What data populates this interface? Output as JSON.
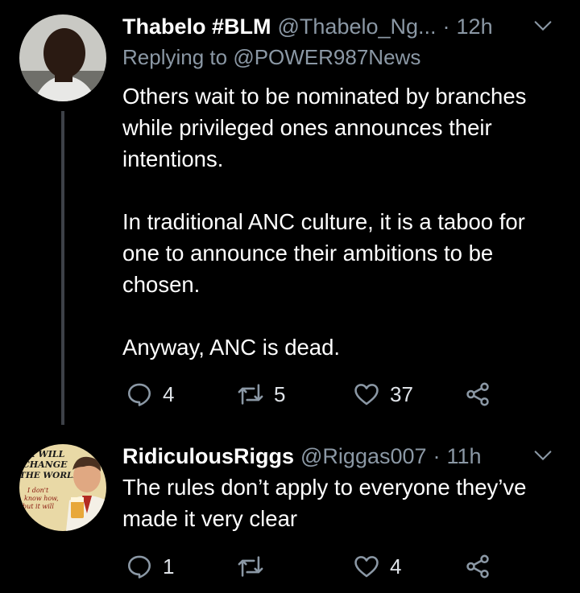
{
  "tweets": [
    {
      "name": "Thabelo #BLM",
      "handle": "@Thabelo_Ng...",
      "dot": "·",
      "time": "12h",
      "replying_prefix": "Replying to ",
      "replying_to": "@POWER987News",
      "paragraphs": [
        "Others wait to be nominated by branches\nwhile privileged ones announces their\nintentions.",
        "In traditional ANC culture, it is a taboo for\none to announce their ambitions to be\nchosen.",
        "Anyway, ANC is dead."
      ],
      "replies": "4",
      "retweets": "5",
      "likes": "37"
    },
    {
      "name": "RidiculousRiggs",
      "handle": "@Riggas007",
      "dot": "·",
      "time": "11h",
      "paragraphs": [
        "The rules don’t apply to everyone they’ve\nmade it very clear"
      ],
      "replies": "1",
      "retweets": "",
      "likes": "4",
      "avatar_text": {
        "l1": "ER WILL",
        "l2": "CHANGE",
        "l3": "THE WORLD",
        "l4": "I don't",
        "l5": "know how,",
        "l6": "but it will"
      }
    }
  ],
  "colors": {
    "background": "#000000",
    "secondary_text": "#8b98a5",
    "primary_text": "#ffffff",
    "thread_line": "#3d4148"
  },
  "icons": [
    "reply-icon",
    "retweet-icon",
    "like-icon",
    "share-icon",
    "chevron-down-icon"
  ]
}
